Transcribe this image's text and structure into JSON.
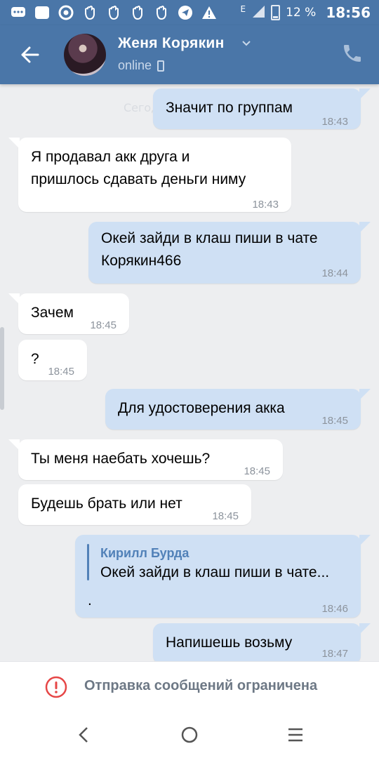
{
  "status_bar": {
    "battery": "12 %",
    "signal_label": "E",
    "time": "18:56",
    "icons": [
      "messages-icon",
      "app-icon",
      "chrome-icon",
      "hand-icon",
      "hand-icon",
      "hand-icon",
      "hand-icon",
      "telegram-icon",
      "warning-icon"
    ]
  },
  "header": {
    "name": "Женя Корякин",
    "status": "online"
  },
  "chat": {
    "date_ghost": "Сегод",
    "messages": [
      {
        "text": "Значит по группам",
        "time": "18:43",
        "dir": "out"
      },
      {
        "text": "Я продавал акк друга и",
        "text2": "пришлось сдавать деньги ниму",
        "time": "18:43",
        "dir": "in"
      },
      {
        "text": "Окей зайди в клаш пиши в чате",
        "text2": "Корякин466",
        "time": "18:44",
        "dir": "out"
      },
      {
        "text": "Зачем",
        "time": "18:45",
        "dir": "in"
      },
      {
        "text": "?",
        "time": "18:45",
        "dir": "in"
      },
      {
        "text": "Для удостоверения акка",
        "time": "18:45",
        "dir": "out"
      },
      {
        "text": "Ты меня наебать хочешь?",
        "time": "18:45",
        "dir": "in"
      },
      {
        "text": "Будешь брать или нет",
        "time": "18:45",
        "dir": "in"
      },
      {
        "fwd_name": "Кирилл Бурда",
        "fwd_text": "Окей зайди в клаш пиши в чате...",
        "text": ".",
        "time": "18:46",
        "dir": "out"
      },
      {
        "text": "Напишешь возьму",
        "time": "18:47",
        "dir": "out"
      }
    ]
  },
  "restriction": {
    "text": "Отправка сообщений ограничена"
  },
  "colors": {
    "header": "#4a76a8",
    "outgoing_bubble": "#cfe0f4",
    "incoming_bubble": "#ffffff",
    "background": "#edeef0",
    "warning": "#e64646"
  }
}
